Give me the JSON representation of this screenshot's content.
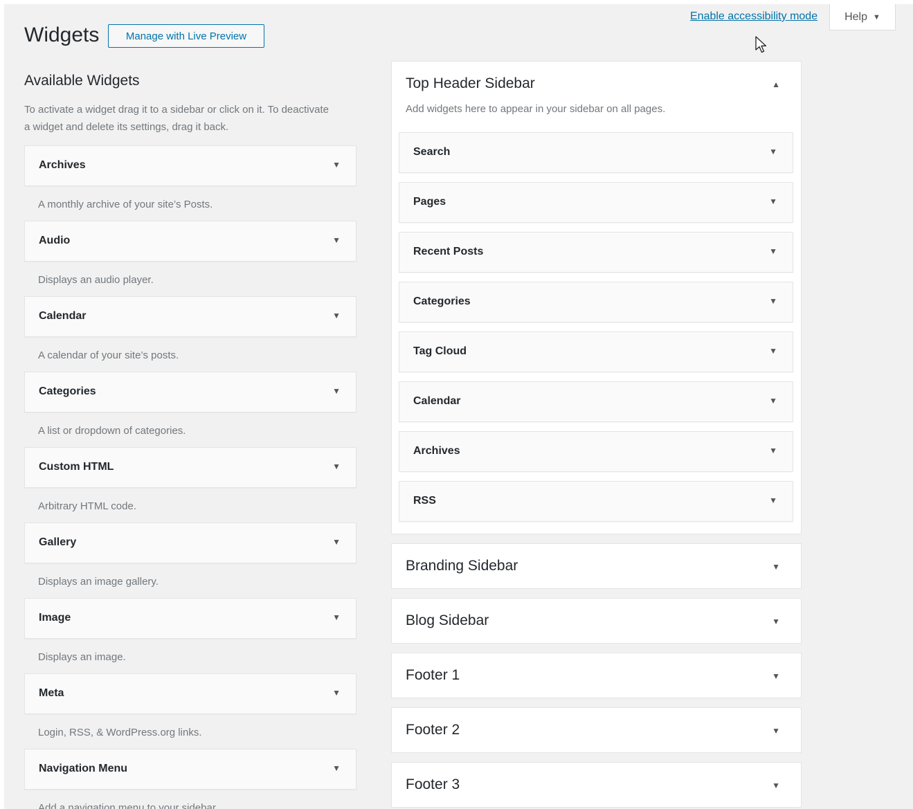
{
  "screen_meta": {
    "accessibility_link": "Enable accessibility mode",
    "help_label": "Help"
  },
  "header": {
    "title": "Widgets",
    "live_preview_button": "Manage with Live Preview"
  },
  "available": {
    "title": "Available Widgets",
    "description": "To activate a widget drag it to a sidebar or click on it. To deactivate a widget and delete its settings, drag it back.",
    "widgets": [
      {
        "name": "Archives",
        "description": "A monthly archive of your site’s Posts."
      },
      {
        "name": "Audio",
        "description": "Displays an audio player."
      },
      {
        "name": "Calendar",
        "description": "A calendar of your site’s posts."
      },
      {
        "name": "Categories",
        "description": "A list or dropdown of categories."
      },
      {
        "name": "Custom HTML",
        "description": "Arbitrary HTML code."
      },
      {
        "name": "Gallery",
        "description": "Displays an image gallery."
      },
      {
        "name": "Image",
        "description": "Displays an image."
      },
      {
        "name": "Meta",
        "description": "Login, RSS, & WordPress.org links."
      },
      {
        "name": "Navigation Menu",
        "description": "Add a navigation menu to your sidebar."
      }
    ]
  },
  "sidebars": {
    "open": {
      "title": "Top Header Sidebar",
      "description": "Add widgets here to appear in your sidebar on all pages.",
      "widgets": [
        "Search",
        "Pages",
        "Recent Posts",
        "Categories",
        "Tag Cloud",
        "Calendar",
        "Archives",
        "RSS"
      ]
    },
    "closed": [
      "Branding Sidebar",
      "Blog Sidebar",
      "Footer 1",
      "Footer 2",
      "Footer 3"
    ]
  },
  "icons": {
    "expanded_toggle": "arrow-up-icon",
    "collapsed_toggle": "arrow-down-icon",
    "cursor": "mouse-pointer-icon"
  },
  "colors": {
    "link": "#0073aa",
    "background": "#f1f1f1",
    "muted_text": "#72777c"
  }
}
